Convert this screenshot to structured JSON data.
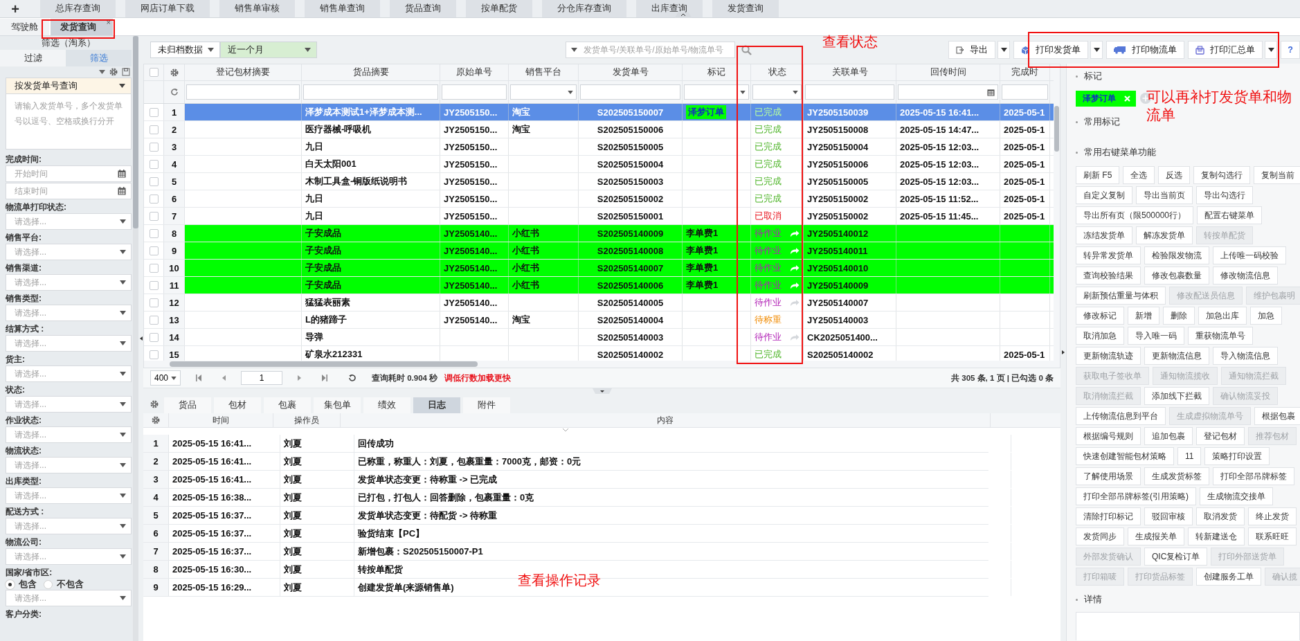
{
  "top_nav": {
    "add_label": "+",
    "tabs": [
      "总库存查询",
      "网店订单下载",
      "销售单审核",
      "销售单查询",
      "货品查询",
      "按单配货",
      "分仓库存查询",
      "出库查询",
      "发货查询"
    ]
  },
  "page_tabs": [
    {
      "label": "驾驶舱",
      "selected": false
    },
    {
      "label": "发货查询",
      "selected": true,
      "close": "×"
    }
  ],
  "filter_panel": {
    "title": "筛选（淘系）",
    "tabs": [
      {
        "label": "过滤",
        "selected": false
      },
      {
        "label": "筛选",
        "selected": true
      }
    ],
    "query_mode": "按发货单号查询",
    "query_placeholder": "请输入发货单号，多个发货单号以逗号、空格或换行分开",
    "date_label": "完成时间:",
    "date_fields": [
      {
        "placeholder": "开始时间"
      },
      {
        "placeholder": "结束时间"
      }
    ],
    "selects": [
      {
        "label": "物流单打印状态:",
        "placeholder": "请选择..."
      },
      {
        "label": "销售平台:",
        "placeholder": "请选择..."
      },
      {
        "label": "销售渠道:",
        "placeholder": "请选择..."
      },
      {
        "label": "销售类型:",
        "placeholder": "请选择..."
      },
      {
        "label": "结算方式 :",
        "placeholder": "请选择..."
      },
      {
        "label": "货主:",
        "placeholder": "请选择..."
      },
      {
        "label": "状态:",
        "placeholder": "请选择..."
      },
      {
        "label": "作业状态:",
        "placeholder": "请选择..."
      },
      {
        "label": "物流状态:",
        "placeholder": "请选择..."
      },
      {
        "label": "出库类型:",
        "placeholder": "请选择..."
      },
      {
        "label": "配送方式 :",
        "placeholder": "请选择..."
      },
      {
        "label": "物流公司:",
        "placeholder": "请选择..."
      }
    ],
    "region": {
      "label": "国家/省市区:",
      "options": [
        {
          "label": "包含",
          "selected": true
        },
        {
          "label": "不包含",
          "selected": false
        }
      ],
      "placeholder": "请选择..."
    },
    "last_label": "客户分类:"
  },
  "toolbar": {
    "archive_filter": "未归档数据",
    "period": "近一个月",
    "search_placeholder": "发货单号/关联单号/原始单号/物流单号",
    "buttons": [
      {
        "label": "导出",
        "dropdown": true
      },
      {
        "label": "打印发货单",
        "dropdown": true
      },
      {
        "label": "打印物流单",
        "dropdown": false
      },
      {
        "label": "打印汇总单",
        "dropdown": true
      },
      {
        "label": "?",
        "dropdown": false
      }
    ]
  },
  "grid": {
    "select_all_checked": false,
    "columns": [
      {
        "label": "登记包材摘要",
        "kind": "text"
      },
      {
        "label": "货品摘要",
        "kind": "text"
      },
      {
        "label": "原始单号",
        "kind": "text"
      },
      {
        "label": "销售平台",
        "kind": "select"
      },
      {
        "label": "发货单号",
        "kind": "text"
      },
      {
        "label": "标记",
        "kind": "select"
      },
      {
        "label": "状态",
        "kind": "select"
      },
      {
        "label": "关联单号",
        "kind": "text"
      },
      {
        "label": "回传时间",
        "kind": "date"
      },
      {
        "label": "完成时",
        "kind": "text"
      }
    ],
    "rows": [
      {
        "no": "1",
        "checked": false,
        "selected": true,
        "goods": "泽梦成本测试1+泽梦成本测...",
        "original_no": "JY2505150...",
        "platform": "淘宝",
        "shipment_no": "S202505150007",
        "mark": {
          "label": "泽梦订单",
          "color": "#00ff00"
        },
        "status": "已完成",
        "kind": "done",
        "forward": false,
        "related_no": "JY2505150039",
        "callback_time": "2025-05-15 16:41...",
        "done_time": "2025-05-1"
      },
      {
        "no": "2",
        "checked": false,
        "selected": false,
        "goods": "医疗器械-呼吸机",
        "original_no": "JY2505150...",
        "platform": "淘宝",
        "shipment_no": "S202505150006",
        "status": "已完成",
        "kind": "done",
        "forward": false,
        "related_no": "JY2505150008",
        "callback_time": "2025-05-15 14:47...",
        "done_time": "2025-05-1"
      },
      {
        "no": "3",
        "checked": false,
        "selected": false,
        "goods": "九日",
        "original_no": "JY2505150...",
        "shipment_no": "S202505150005",
        "status": "已完成",
        "kind": "done",
        "forward": false,
        "related_no": "JY2505150004",
        "callback_time": "2025-05-15 12:03...",
        "done_time": "2025-05-1"
      },
      {
        "no": "4",
        "checked": false,
        "selected": false,
        "goods": "白天太阳001",
        "original_no": "JY2505150...",
        "shipment_no": "S202505150004",
        "status": "已完成",
        "kind": "done",
        "forward": false,
        "related_no": "JY2505150006",
        "callback_time": "2025-05-15 12:03...",
        "done_time": "2025-05-1"
      },
      {
        "no": "5",
        "checked": false,
        "selected": false,
        "goods": "木制工具盒-铜版纸说明书",
        "original_no": "JY2505150...",
        "shipment_no": "S202505150003",
        "status": "已完成",
        "kind": "done",
        "forward": false,
        "related_no": "JY2505150005",
        "callback_time": "2025-05-15 12:03...",
        "done_time": "2025-05-1"
      },
      {
        "no": "6",
        "checked": false,
        "selected": false,
        "goods": "九日",
        "original_no": "JY2505150...",
        "shipment_no": "S202505150002",
        "status": "已完成",
        "kind": "done",
        "forward": false,
        "related_no": "JY2505150002",
        "callback_time": "2025-05-15 11:52...",
        "done_time": "2025-05-1"
      },
      {
        "no": "7",
        "checked": false,
        "selected": false,
        "goods": "九日",
        "original_no": "JY2505150...",
        "shipment_no": "S202505150001",
        "status": "已取消",
        "kind": "cancelled",
        "forward": false,
        "related_no": "JY2505150002",
        "callback_time": "2025-05-15 11:45...",
        "done_time": "2025-05-1"
      },
      {
        "no": "8",
        "checked": false,
        "selected": false,
        "color": "#00ff00",
        "goods": "子安成品",
        "original_no": "JY2505140...",
        "platform": "小红书",
        "shipment_no": "S202505140009",
        "mark": "李单费1",
        "status": "待作业",
        "kind": "pending",
        "forward": true,
        "related_no": "JY2505140012"
      },
      {
        "no": "9",
        "checked": false,
        "selected": false,
        "color": "#00ff00",
        "goods": "子安成品",
        "original_no": "JY2505140...",
        "platform": "小红书",
        "shipment_no": "S202505140008",
        "mark": "李单费1",
        "status": "待作业",
        "kind": "pending",
        "forward": true,
        "related_no": "JY2505140011"
      },
      {
        "no": "10",
        "checked": false,
        "selected": false,
        "color": "#00ff00",
        "goods": "子安成品",
        "original_no": "JY2505140...",
        "platform": "小红书",
        "shipment_no": "S202505140007",
        "mark": "李单费1",
        "status": "待作业",
        "kind": "pending",
        "forward": true,
        "related_no": "JY2505140010"
      },
      {
        "no": "11",
        "checked": false,
        "selected": false,
        "color": "#00ff00",
        "goods": "子安成品",
        "original_no": "JY2505140...",
        "platform": "小红书",
        "shipment_no": "S202505140006",
        "mark": "李单费1",
        "status": "待作业",
        "kind": "pending",
        "forward": true,
        "related_no": "JY2505140009"
      },
      {
        "no": "12",
        "checked": false,
        "selected": false,
        "goods": "猛猛表丽素",
        "original_no": "JY2505140...",
        "shipment_no": "S202505140005",
        "status": "待作业",
        "kind": "pending",
        "forward": true,
        "related_no": "JY2505140007"
      },
      {
        "no": "13",
        "checked": false,
        "selected": false,
        "goods": "L的猪蹄子",
        "original_no": "JY2505140...",
        "platform": "淘宝",
        "shipment_no": "S202505140004",
        "status": "待称重",
        "kind": "weighing",
        "forward": false,
        "related_no": "JY2505140003"
      },
      {
        "no": "14",
        "checked": false,
        "selected": false,
        "goods": "导弹",
        "shipment_no": "S202505140003",
        "status": "待作业",
        "kind": "pending",
        "forward": true,
        "related_no": "CK2025051400..."
      },
      {
        "no": "15",
        "checked": false,
        "selected": false,
        "goods": "矿泉水212331",
        "shipment_no": "S202505140002",
        "status": "已完成",
        "kind": "done",
        "forward": false,
        "related_no": "S202505140002",
        "done_time": "2025-05-1"
      }
    ]
  },
  "pager": {
    "page_size": "400",
    "page": "1",
    "query_time": "查询耗时 0.904 秒",
    "hint": "调低行数加载更快",
    "summary": "共 305 条, 1 页 | 已勾选 0 条"
  },
  "detail_tabs": [
    {
      "label": "货品",
      "selected": false
    },
    {
      "label": "包材",
      "selected": false
    },
    {
      "label": "包裹",
      "selected": false
    },
    {
      "label": "集包单",
      "selected": false
    },
    {
      "label": "绩效",
      "selected": false
    },
    {
      "label": "日志",
      "selected": true
    },
    {
      "label": "附件",
      "selected": false
    }
  ],
  "log": {
    "columns": [
      "时间",
      "操作员",
      "内容"
    ],
    "rows": [
      {
        "no": "1",
        "time": "2025-05-15 16:41...",
        "operator": "刘夏",
        "content": "回传成功"
      },
      {
        "no": "2",
        "time": "2025-05-15 16:41...",
        "operator": "刘夏",
        "content": "已称重，称重人：刘夏，包裹重量：7000克，邮资：0元"
      },
      {
        "no": "3",
        "time": "2025-05-15 16:41...",
        "operator": "刘夏",
        "content": "发货单状态变更：待称重 -> 已完成"
      },
      {
        "no": "4",
        "time": "2025-05-15 16:38...",
        "operator": "刘夏",
        "content": "已打包，打包人：回答删除，包裹重量：0克"
      },
      {
        "no": "5",
        "time": "2025-05-15 16:37...",
        "operator": "刘夏",
        "content": "发货单状态变更：待配货 -> 待称重"
      },
      {
        "no": "6",
        "time": "2025-05-15 16:37...",
        "operator": "刘夏",
        "content": "验货结束【PC】"
      },
      {
        "no": "7",
        "time": "2025-05-15 16:37...",
        "operator": "刘夏",
        "content": "新增包裹：S202505150007-P1"
      },
      {
        "no": "8",
        "time": "2025-05-15 16:30...",
        "operator": "刘夏",
        "content": "转按单配货"
      },
      {
        "no": "9",
        "time": "2025-05-15 16:29...",
        "operator": "刘夏",
        "content": "创建发货单(来源销售单)"
      }
    ]
  },
  "right_panel": {
    "mark_title": "标记",
    "tags": [
      {
        "label": "泽梦订单",
        "color": "#00ff00"
      }
    ],
    "common_marks_title": "常用标记",
    "menu_title": "常用右键菜单功能",
    "menu_rows": [
      [
        {
          "label": "刷新  F5",
          "disabled": false
        },
        {
          "label": "全选",
          "disabled": false
        },
        {
          "label": "反选",
          "disabled": false
        },
        {
          "label": "复制勾选行",
          "disabled": false
        },
        {
          "label": "复制当前",
          "disabled": false
        }
      ],
      [
        {
          "label": "自定义复制",
          "disabled": false
        },
        {
          "label": "导出当前页",
          "disabled": false
        },
        {
          "label": "导出勾选行",
          "disabled": false
        }
      ],
      [
        {
          "label": "导出所有页（限500000行）",
          "disabled": false
        },
        {
          "label": "配置右键菜单",
          "disabled": false
        }
      ],
      [
        {
          "label": "冻结发货单",
          "disabled": false
        },
        {
          "label": "解冻发货单",
          "disabled": false
        },
        {
          "label": "转按单配货",
          "disabled": true
        }
      ],
      [
        {
          "label": "转异常发货单",
          "disabled": false
        },
        {
          "label": "检验限发物流",
          "disabled": false
        },
        {
          "label": "上传唯一码校验",
          "disabled": false
        }
      ],
      [
        {
          "label": "查询校验结果",
          "disabled": false
        },
        {
          "label": "修改包裹数量",
          "disabled": false
        },
        {
          "label": "修改物流信息",
          "disabled": false
        }
      ],
      [
        {
          "label": "刷新预估重量与体积",
          "disabled": false
        },
        {
          "label": "修改配送员信息",
          "disabled": true
        },
        {
          "label": "维护包裹明",
          "disabled": true
        }
      ],
      [
        {
          "label": "修改标记",
          "disabled": false
        },
        {
          "label": "新增",
          "disabled": false
        },
        {
          "label": "删除",
          "disabled": false
        },
        {
          "label": "加急出库",
          "disabled": false
        },
        {
          "label": "加急",
          "disabled": false
        }
      ],
      [
        {
          "label": "取消加急",
          "disabled": false
        },
        {
          "label": "导入唯一码",
          "disabled": false
        },
        {
          "label": "重获物流单号",
          "disabled": false
        }
      ],
      [
        {
          "label": "更新物流轨迹",
          "disabled": false
        },
        {
          "label": "更新物流信息",
          "disabled": false
        },
        {
          "label": "导入物流信息",
          "disabled": false
        }
      ],
      [
        {
          "label": "获取电子签收单",
          "disabled": true
        },
        {
          "label": "通知物流揽收",
          "disabled": true
        },
        {
          "label": "通知物流拦截",
          "disabled": true
        }
      ],
      [
        {
          "label": "取消物流拦截",
          "disabled": true
        },
        {
          "label": "添加线下拦截",
          "disabled": false
        },
        {
          "label": "确认物流妥投",
          "disabled": true
        }
      ],
      [
        {
          "label": "上传物流信息到平台",
          "disabled": false
        },
        {
          "label": "生成虚拟物流单号",
          "disabled": true
        },
        {
          "label": "根据包裹",
          "disabled": false
        }
      ],
      [
        {
          "label": "根据编号规则",
          "disabled": false
        },
        {
          "label": "追加包裹",
          "disabled": false
        },
        {
          "label": "登记包材",
          "disabled": false
        },
        {
          "label": "推荐包材",
          "disabled": true
        }
      ],
      [
        {
          "label": "快速创建智能包材策略",
          "disabled": false
        },
        {
          "label": "11",
          "disabled": false
        },
        {
          "label": "策略打印设置",
          "disabled": false
        }
      ],
      [
        {
          "label": "了解使用场景",
          "disabled": false
        },
        {
          "label": "生成发货标签",
          "disabled": false
        },
        {
          "label": "打印全部吊牌标签",
          "disabled": false
        }
      ],
      [
        {
          "label": "打印全部吊牌标签(引用策略)",
          "disabled": false
        },
        {
          "label": "生成物流交接单",
          "disabled": false
        }
      ],
      [
        {
          "label": "清除打印标记",
          "disabled": false
        },
        {
          "label": "驳回审核",
          "disabled": false
        },
        {
          "label": "取消发货",
          "disabled": false
        },
        {
          "label": "终止发货",
          "disabled": false
        }
      ],
      [
        {
          "label": "发货同步",
          "disabled": false
        },
        {
          "label": "生成报关单",
          "disabled": false
        },
        {
          "label": "转新建送仓",
          "disabled": false
        },
        {
          "label": "联系旺旺",
          "disabled": false
        }
      ],
      [
        {
          "label": "外部发货确认",
          "disabled": true
        },
        {
          "label": "QIC复检订单",
          "disabled": false
        },
        {
          "label": "打印外部送货单",
          "disabled": true
        }
      ],
      [
        {
          "label": "打印箱唛",
          "disabled": true
        },
        {
          "label": "打印货品标签",
          "disabled": true
        },
        {
          "label": "创建服务工单",
          "disabled": false
        },
        {
          "label": "确认揽",
          "disabled": true
        }
      ]
    ],
    "detail_title": "详情"
  },
  "annotations": [
    {
      "text": "查看状态"
    },
    {
      "text": "可以再补打发货单和物流单"
    },
    {
      "text": "查看操作记录"
    }
  ]
}
